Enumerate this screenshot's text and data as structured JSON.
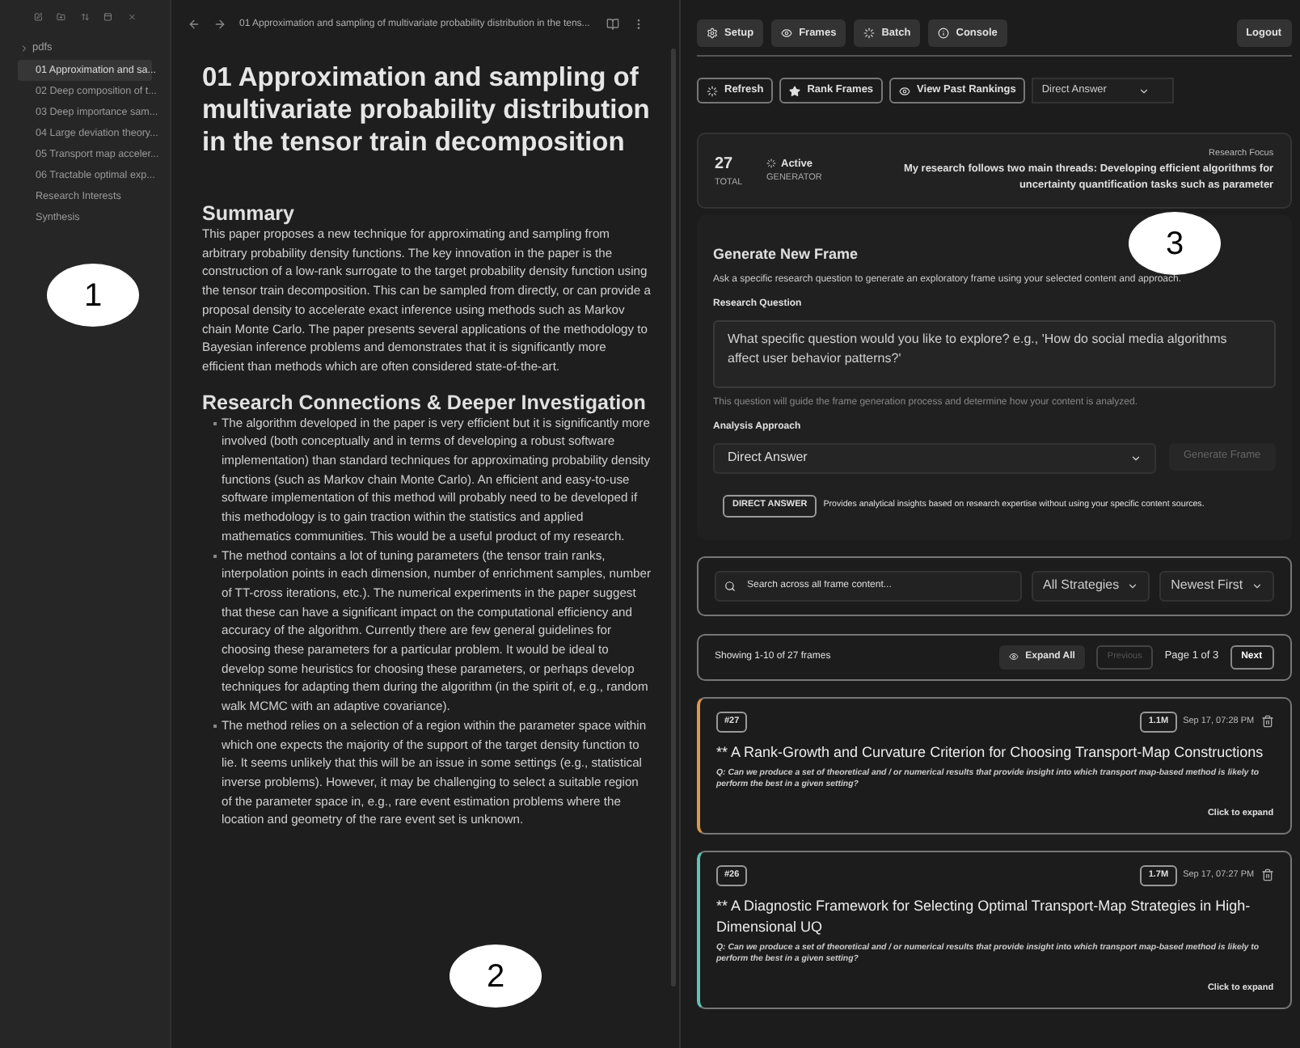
{
  "sidebar": {
    "folder": {
      "label": "pdfs",
      "expanded": false
    },
    "items": [
      {
        "label": "01 Approximation and sa...",
        "selected": true
      },
      {
        "label": "02 Deep composition of t...",
        "selected": false
      },
      {
        "label": "03 Deep importance sam...",
        "selected": false
      },
      {
        "label": "04 Large deviation theory...",
        "selected": false
      },
      {
        "label": "05 Transport map acceler...",
        "selected": false
      },
      {
        "label": "06 Tractable optimal exp...",
        "selected": false
      },
      {
        "label": "Research Interests",
        "selected": false
      },
      {
        "label": "Synthesis",
        "selected": false
      }
    ]
  },
  "editor": {
    "tab_title": "01 Approximation and sampling of multivariate probability distribution in the tens...",
    "title": "01 Approximation and sampling of multivariate probability distribution in the tensor train decomposition",
    "summary_heading": "Summary",
    "summary": "This paper proposes a new technique for approximating and sampling from arbitrary probability density functions. The key innovation in the paper is the construction of a low-rank surrogate to the target probability density function using the tensor train decomposition. This can be sampled from directly, or can provide a proposal density to accelerate exact inference using methods such as Markov chain Monte Carlo. The paper presents several applications of the methodology to Bayesian inference problems and demonstrates that it is significantly more efficient than methods which are often considered state-of-the-art.",
    "research_heading": "Research Connections & Deeper Investigation",
    "bullets": [
      "The algorithm developed in the paper is very efficient but it is significantly more involved (both conceptually and in terms of developing a robust software implementation) than standard techniques for approximating probability density functions (such as Markov chain Monte Carlo). An efficient and easy-to-use software implementation of this method will probably need to be developed if this methodology is to gain traction within the statistics and applied mathematics communities. This would be a useful product of my research.",
      "The method contains a lot of tuning parameters (the tensor train ranks, interpolation points in each dimension, number of enrichment samples, number of TT-cross iterations, etc.). The numerical experiments in the paper suggest that these can have a significant impact on the computational efficiency and accuracy of the algorithm. Currently there are few general guidelines for choosing these parameters for a particular problem. It would be ideal to develop some heuristics for choosing these parameters, or perhaps develop techniques for adapting them during the algorithm (in the spirit of, e.g., random walk MCMC with an adaptive covariance).",
      "The method relies on a selection of a region within the parameter space within which one expects the majority of the support of the target density function to lie. It seems unlikely that this will be an issue in some settings (e.g., statistical inverse problems). However, it may be challenging to select a suitable region of the parameter space in, e.g., rare event estimation problems where the location and geometry of the rare event set is unknown."
    ]
  },
  "panel": {
    "nav": [
      {
        "label": "Setup",
        "kind": "gear"
      },
      {
        "label": "Frames",
        "kind": "eye"
      },
      {
        "label": "Batch",
        "kind": "spinner"
      },
      {
        "label": "Console",
        "kind": "info"
      }
    ],
    "logout": "Logout",
    "toolbar": [
      {
        "label": "Refresh",
        "kind": "spinner"
      },
      {
        "label": "Rank Frames",
        "kind": "star"
      },
      {
        "label": "View Past Rankings",
        "kind": "eye"
      }
    ],
    "approach_select": "Direct Answer",
    "stats": {
      "total": "27",
      "total_label": "TOTAL",
      "status": "Active",
      "status_label": "GENERATOR",
      "focus_label": "Research Focus",
      "focus": "My research follows two main threads: Developing efficient algorithms for uncertainty quantification tasks such as parameter"
    },
    "generate": {
      "heading": "Generate New Frame",
      "description": "Ask a specific research question to generate an exploratory frame using your selected content and approach.",
      "question_label": "Research Question",
      "question_placeholder": "What specific question would you like to explore? e.g., 'How do social media algorithms affect user behavior patterns?'",
      "hint": "This question will guide the frame generation process and determine how your content is analyzed.",
      "approach_label": "Analysis Approach",
      "approach": "Direct Answer",
      "button": {
        "label": "Generate Frame",
        "disabled": true
      },
      "badge": "DIRECT ANSWER",
      "badge_text": "Provides analytical insights based on research expertise without using your specific content sources."
    },
    "search": {
      "placeholder": "Search across all frame content...",
      "filters": [
        "All Strategies",
        "Newest First"
      ]
    },
    "pagination": {
      "showing": "Showing 1-10 of 27 frames",
      "expand": "Expand All",
      "previous": {
        "label": "Previous",
        "disabled": true
      },
      "page": "Page 1 of 3",
      "next": {
        "label": "Next",
        "disabled": false
      }
    },
    "frames": [
      {
        "number": "#27",
        "size": "1.1M",
        "time": "Sep 17, 07:28 PM",
        "title": "** A Rank-Growth and Curvature Criterion for Choosing Transport-Map Constructions",
        "question": "Q: Can we produce a set of theoretical and / or numerical results that provide insight into which transport map-based method is likely to perform the best in a given setting?",
        "expand": "Click to expand",
        "color": "#d99a4e"
      },
      {
        "number": "#26",
        "size": "1.7M",
        "time": "Sep 17, 07:27 PM",
        "title": "** A Diagnostic Framework for Selecting Optimal Transport-Map Strategies in High-Dimensional UQ",
        "question": "Q: Can we produce a set of theoretical and / or numerical results that provide insight into which transport map-based method is likely to perform the best in a given setting?",
        "expand": "Click to expand",
        "color": "#5fc4b4"
      }
    ]
  },
  "callouts": [
    "1",
    "2",
    "3"
  ]
}
